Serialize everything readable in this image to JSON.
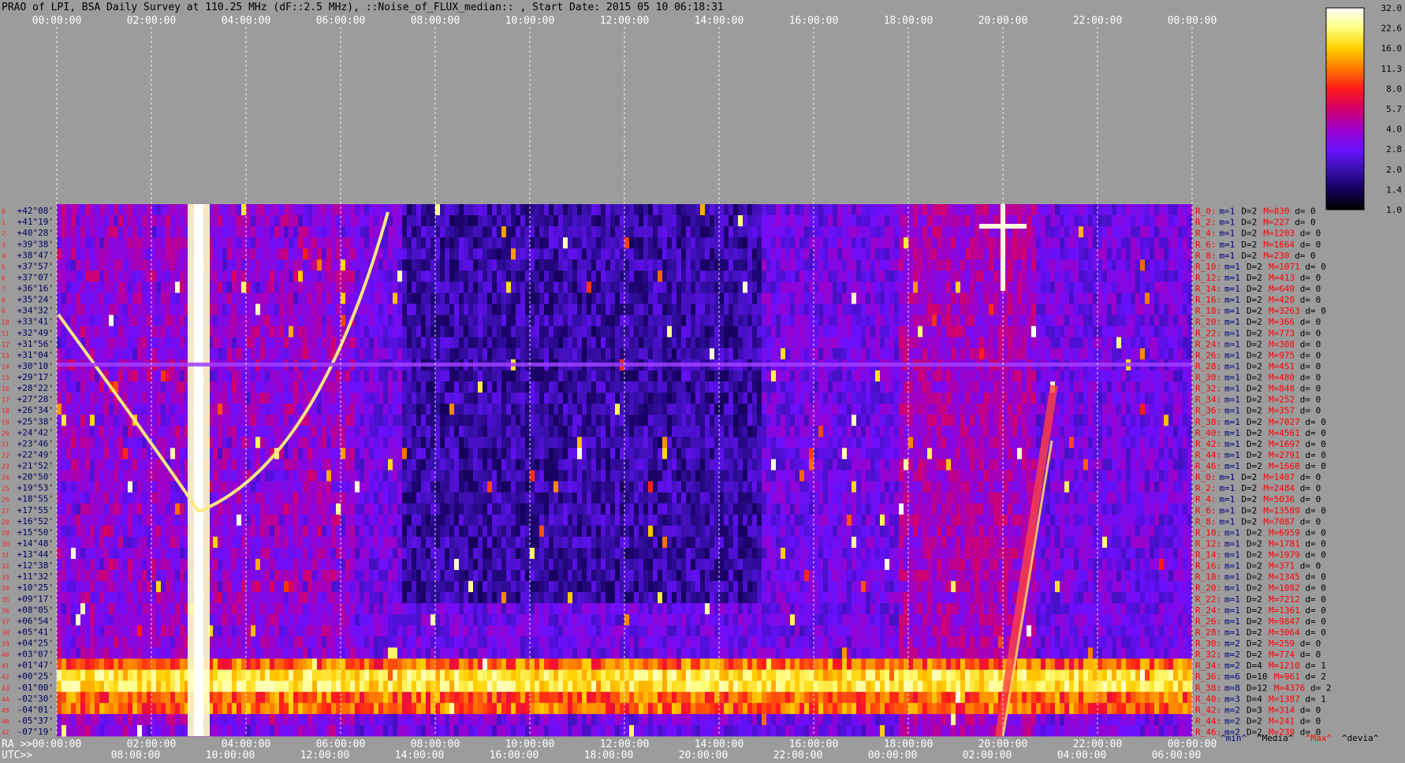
{
  "title": "PRAO of LPI, BSA Daily Survey at 110.25 MHz (dF::2.5 MHz), ::Noise_of_FLUX_median:: , Start Date: 2015 05 10 06:18:31",
  "chart_data": {
    "type": "heatmap",
    "title": "PRAO of LPI, BSA Daily Survey at 110.25 MHz (dF::2.5 MHz), ::Noise_of_FLUX_median:: , Start Date: 2015 05 10 06:18:31",
    "top_axis_ticks": [
      "00:00:00",
      "02:00:00",
      "04:00:00",
      "06:00:00",
      "08:00:00",
      "10:00:00",
      "12:00:00",
      "14:00:00",
      "16:00:00",
      "18:00:00",
      "20:00:00",
      "22:00:00",
      "00:00:00"
    ],
    "ra_axis_label": "RA >>",
    "ra_ticks": [
      "00:00:00",
      "02:00:00",
      "04:00:00",
      "06:00:00",
      "08:00:00",
      "10:00:00",
      "12:00:00",
      "14:00:00",
      "16:00:00",
      "18:00:00",
      "20:00:00",
      "22:00:00",
      "00:00:00"
    ],
    "utc_axis_label": "UTC>>",
    "utc_ticks": [
      "08:00:00",
      "10:00:00",
      "12:00:00",
      "14:00:00",
      "16:00:00",
      "18:00:00",
      "20:00:00",
      "22:00:00",
      "00:00:00",
      "02:00:00",
      "04:00:00",
      "06:00:00"
    ],
    "declinations": [
      "+42°08'",
      "+41°19'",
      "+40°28'",
      "+39°38'",
      "+38°47'",
      "+37°57'",
      "+37°07'",
      "+36°16'",
      "+35°24'",
      "+34°32'",
      "+33°41'",
      "+32°49'",
      "+31°56'",
      "+31°04'",
      "+30°10'",
      "+29°17'",
      "+28°22'",
      "+27°28'",
      "+26°34'",
      "+25°38'",
      "+24°42'",
      "+23°46'",
      "+22°49'",
      "+21°52'",
      "+20°50'",
      "+19°53'",
      "+18°55'",
      "+17°55'",
      "+16°52'",
      "+15°50'",
      "+14°48'",
      "+13°44'",
      "+12°38'",
      "+11°32'",
      "+10°25'",
      "+09°17'",
      "+08°05'",
      "+06°54'",
      "+05°41'",
      "+04°25'",
      "+03°07'",
      "+01°47'",
      "+00°25'",
      "-01°00'",
      "-02°30'",
      "-04°01'",
      "-05°37'",
      "-07°19'"
    ],
    "colorbar": {
      "ticks": [
        "32.0",
        "22.6",
        "16.0",
        "11.3",
        "8.0",
        "5.7",
        "4.0",
        "2.8",
        "2.0",
        "1.4",
        "1.0"
      ],
      "colors": [
        "#ffffff",
        "#ffff80",
        "#ffd000",
        "#ff7a00",
        "#ff1a1a",
        "#d4006a",
        "#9d00c8",
        "#6a10ff",
        "#3a10b0",
        "#14005a",
        "#000000"
      ]
    },
    "row_stats": [
      {
        "label": "R_0:",
        "m": 1,
        "D": 2,
        "M": 830,
        "d": 0
      },
      {
        "label": "R_2:",
        "m": 1,
        "D": 2,
        "M": 227,
        "d": 0
      },
      {
        "label": "R_4:",
        "m": 1,
        "D": 2,
        "M": 1203,
        "d": 0
      },
      {
        "label": "R_6:",
        "m": 1,
        "D": 2,
        "M": 1664,
        "d": 0
      },
      {
        "label": "R_8:",
        "m": 1,
        "D": 2,
        "M": 230,
        "d": 0
      },
      {
        "label": "R_10:",
        "m": 1,
        "D": 2,
        "M": 1071,
        "d": 0
      },
      {
        "label": "R_12:",
        "m": 1,
        "D": 2,
        "M": 413,
        "d": 0
      },
      {
        "label": "R_14:",
        "m": 1,
        "D": 2,
        "M": 640,
        "d": 0
      },
      {
        "label": "R_16:",
        "m": 1,
        "D": 2,
        "M": 420,
        "d": 0
      },
      {
        "label": "R_18:",
        "m": 1,
        "D": 2,
        "M": 3263,
        "d": 0
      },
      {
        "label": "R_20:",
        "m": 1,
        "D": 2,
        "M": 366,
        "d": 0
      },
      {
        "label": "R_22:",
        "m": 1,
        "D": 2,
        "M": 773,
        "d": 0
      },
      {
        "label": "R_24:",
        "m": 1,
        "D": 2,
        "M": 308,
        "d": 0
      },
      {
        "label": "R_26:",
        "m": 1,
        "D": 2,
        "M": 975,
        "d": 0
      },
      {
        "label": "R_28:",
        "m": 1,
        "D": 2,
        "M": 451,
        "d": 0
      },
      {
        "label": "R_30:",
        "m": 1,
        "D": 2,
        "M": 480,
        "d": 0
      },
      {
        "label": "R_32:",
        "m": 1,
        "D": 2,
        "M": 848,
        "d": 0
      },
      {
        "label": "R_34:",
        "m": 1,
        "D": 2,
        "M": 252,
        "d": 0
      },
      {
        "label": "R_36:",
        "m": 1,
        "D": 2,
        "M": 357,
        "d": 0
      },
      {
        "label": "R_38:",
        "m": 1,
        "D": 2,
        "M": 7027,
        "d": 0
      },
      {
        "label": "R_40:",
        "m": 1,
        "D": 2,
        "M": 4561,
        "d": 0
      },
      {
        "label": "R_42:",
        "m": 1,
        "D": 2,
        "M": 1697,
        "d": 0
      },
      {
        "label": "R_44:",
        "m": 1,
        "D": 2,
        "M": 2791,
        "d": 0
      },
      {
        "label": "R_46:",
        "m": 1,
        "D": 2,
        "M": 1668,
        "d": 0
      },
      {
        "label": "R_0:",
        "m": 1,
        "D": 2,
        "M": 1407,
        "d": 0
      },
      {
        "label": "R_2:",
        "m": 1,
        "D": 2,
        "M": 2484,
        "d": 0
      },
      {
        "label": "R_4:",
        "m": 1,
        "D": 2,
        "M": 5036,
        "d": 0
      },
      {
        "label": "R_6:",
        "m": 1,
        "D": 2,
        "M": 13589,
        "d": 0
      },
      {
        "label": "R_8:",
        "m": 1,
        "D": 2,
        "M": 7087,
        "d": 0
      },
      {
        "label": "R_10:",
        "m": 1,
        "D": 2,
        "M": 6959,
        "d": 0
      },
      {
        "label": "R_12:",
        "m": 1,
        "D": 2,
        "M": 1781,
        "d": 0
      },
      {
        "label": "R_14:",
        "m": 1,
        "D": 2,
        "M": 1979,
        "d": 0
      },
      {
        "label": "R_16:",
        "m": 1,
        "D": 2,
        "M": 371,
        "d": 0
      },
      {
        "label": "R_18:",
        "m": 1,
        "D": 2,
        "M": 1345,
        "d": 0
      },
      {
        "label": "R_20:",
        "m": 1,
        "D": 2,
        "M": 1082,
        "d": 0
      },
      {
        "label": "R_22:",
        "m": 1,
        "D": 2,
        "M": 7212,
        "d": 0
      },
      {
        "label": "R_24:",
        "m": 1,
        "D": 2,
        "M": 1361,
        "d": 0
      },
      {
        "label": "R_26:",
        "m": 1,
        "D": 2,
        "M": 9847,
        "d": 0
      },
      {
        "label": "R_28:",
        "m": 1,
        "D": 2,
        "M": 3064,
        "d": 0
      },
      {
        "label": "R_30:",
        "m": 2,
        "D": 2,
        "M": 259,
        "d": 0
      },
      {
        "label": "R_32:",
        "m": 2,
        "D": 2,
        "M": 774,
        "d": 0
      },
      {
        "label": "R_34:",
        "m": 2,
        "D": 4,
        "M": 1210,
        "d": 1
      },
      {
        "label": "R_36:",
        "m": 6,
        "D": 10,
        "M": 961,
        "d": 2
      },
      {
        "label": "R_38:",
        "m": 8,
        "D": 12,
        "M": 4376,
        "d": 2
      },
      {
        "label": "R_40:",
        "m": 3,
        "D": 4,
        "M": 1387,
        "d": 1
      },
      {
        "label": "R_42:",
        "m": 2,
        "D": 3,
        "M": 314,
        "d": 0
      },
      {
        "label": "R_44:",
        "m": 2,
        "D": 2,
        "M": 241,
        "d": 0
      },
      {
        "label": "R_46:",
        "m": 2,
        "D": 2,
        "M": 239,
        "d": 0
      }
    ],
    "stats_legend": [
      "^min^",
      "^Media^",
      "^Max^",
      "^devia^"
    ],
    "stats_legend_colors": [
      "#000080",
      "#000000",
      "#ff0000",
      "#000000"
    ]
  }
}
